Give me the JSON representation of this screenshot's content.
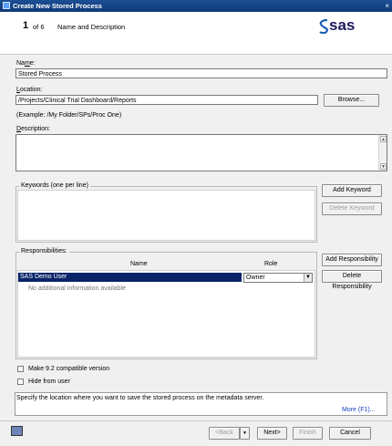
{
  "window": {
    "title": "Create New Stored Process",
    "close_glyph": "×"
  },
  "header": {
    "step_number": "1",
    "step_of": "of 6",
    "step_title": "Name and Description",
    "logo_text": "sas"
  },
  "name": {
    "label_prefix": "Na",
    "label_key": "m",
    "label_suffix": "e:",
    "value": "Stored Process"
  },
  "location": {
    "label_key": "L",
    "label_suffix": "ocation:",
    "value": "/Projects/Clinical Trial Dashboard/Reports",
    "browse_label": "Browse...",
    "example": "(Example: /My Folder/SPs/Proc One)"
  },
  "description": {
    "label_key": "D",
    "label_suffix": "escription:",
    "value": ""
  },
  "keywords": {
    "legend": "Keywords (one per line)",
    "add_label": "Add Keyword",
    "delete_label": "Delete Keyword"
  },
  "responsibilities": {
    "legend": "Responsibilities:",
    "col_name": "Name",
    "col_role": "Role",
    "row_name": "SAS Demo User",
    "row_role": "Owner",
    "empty_text": "No additional information available",
    "add_label": "Add Responsibility",
    "delete_label": "Delete Responsibility"
  },
  "options": {
    "compat_label": "Make 9.2 compatible version",
    "hide_label": "Hide from user"
  },
  "status": {
    "text": "Specify the location where you want to save the stored process on the metadata server.",
    "more_label": "More (F1)..."
  },
  "footer": {
    "back_label": "<Back",
    "next_label": "Next>",
    "finish_label": "Finish",
    "cancel_label": "Cancel"
  },
  "colors": {
    "title_bar": "#1d4f94",
    "selection": "#0a246a",
    "link": "#1a3fbf",
    "logo": "#1a1a5e"
  }
}
